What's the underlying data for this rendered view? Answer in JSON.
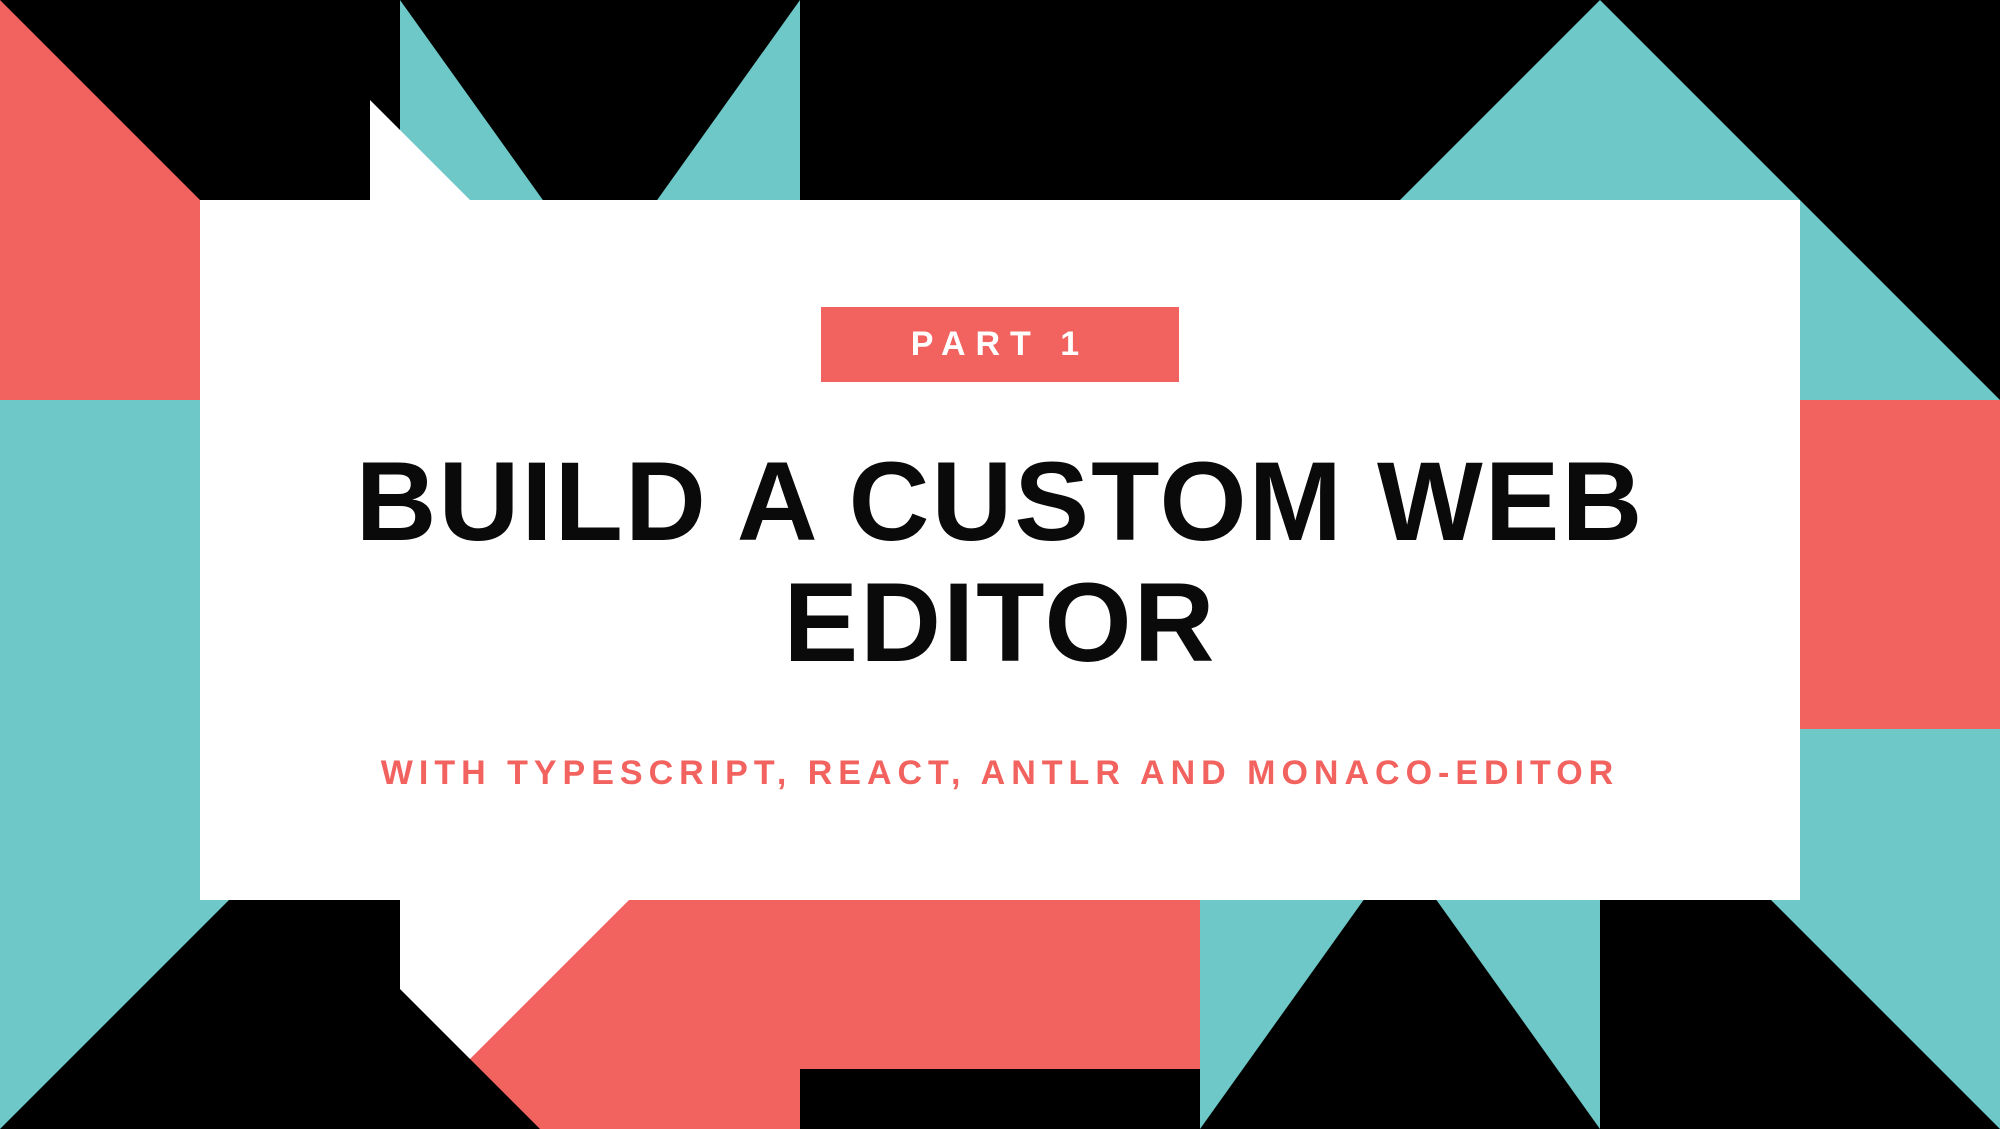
{
  "badge": "PART 1",
  "title": "BUILD A CUSTOM WEB EDITOR",
  "subtitle": "WITH TYPESCRIPT, REACT, ANTLR AND MONACO-EDITOR",
  "colors": {
    "teal": "#6ec8c8",
    "coral": "#f2625f",
    "black": "#000000",
    "white": "#ffffff"
  }
}
